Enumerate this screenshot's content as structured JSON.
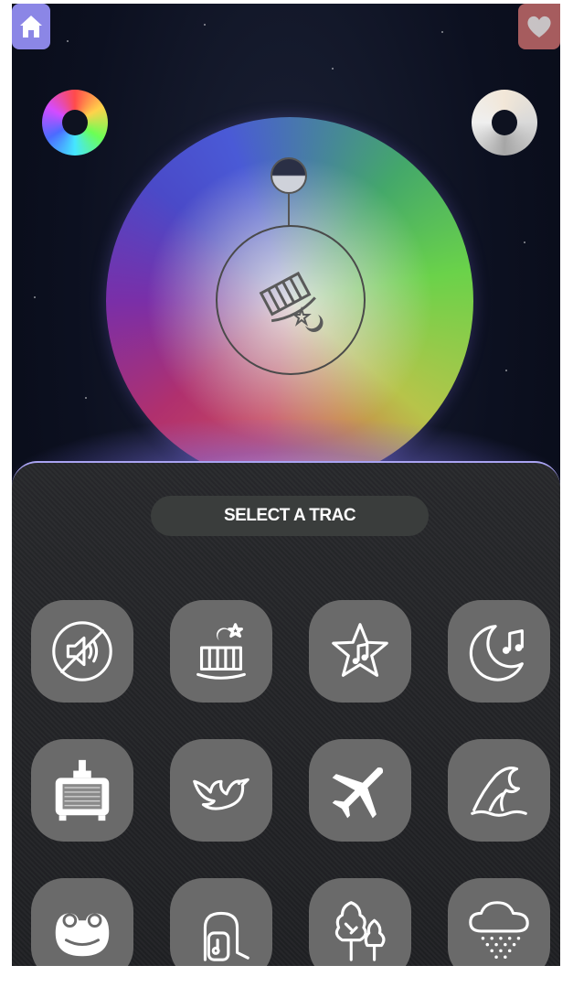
{
  "header": {
    "home_icon": "home-icon",
    "favorite_icon": "heart-icon"
  },
  "color_controls": {
    "left_ring_icon": "color-ring-icon",
    "right_ring_icon": "white-ring-icon"
  },
  "wheel": {
    "center_icon": "crib-moon-star-icon"
  },
  "panel": {
    "title": "SELECT A TRAC",
    "tracks": [
      {
        "id": "no-sound",
        "icon": "sound-off-icon"
      },
      {
        "id": "lullaby-crib",
        "icon": "crib-icon"
      },
      {
        "id": "star-music",
        "icon": "star-note-icon"
      },
      {
        "id": "moon-music",
        "icon": "moon-note-icon"
      },
      {
        "id": "tv-static",
        "icon": "tv-icon"
      },
      {
        "id": "bird",
        "icon": "bird-icon"
      },
      {
        "id": "airplane",
        "icon": "airplane-icon"
      },
      {
        "id": "ocean-wave",
        "icon": "wave-icon"
      },
      {
        "id": "frog",
        "icon": "frog-icon"
      },
      {
        "id": "vacuum",
        "icon": "vacuum-icon"
      },
      {
        "id": "forest",
        "icon": "trees-icon"
      },
      {
        "id": "rain",
        "icon": "rain-cloud-icon"
      }
    ]
  },
  "colors": {
    "accent": "#8b86e6",
    "panel_border": "#a9a3f2",
    "tile": "#6a6a6a",
    "favorite": "#c26a6a"
  }
}
